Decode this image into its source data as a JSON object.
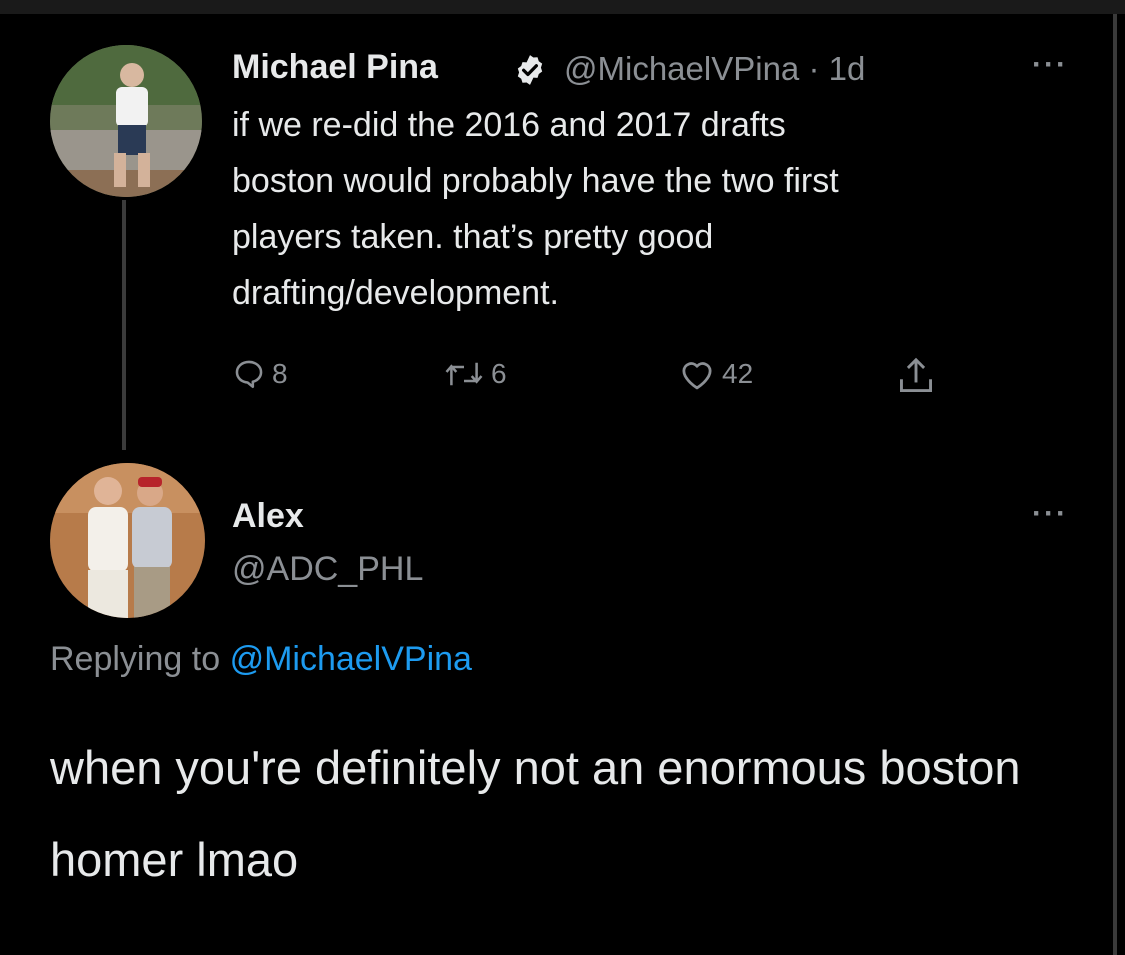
{
  "tweet": {
    "author_name": "Michael Pina",
    "verified": true,
    "handle": "@MichaelVPina",
    "separator": "·",
    "time": "1d",
    "text_lines": [
      "if we re-did the 2016 and 2017 drafts",
      "boston would probably have the two first",
      "players taken. that’s pretty good",
      "drafting/development."
    ],
    "more_label": "···",
    "reply_count": "8",
    "retweet_count": "6",
    "like_count": "42"
  },
  "reply": {
    "author_name": "Alex",
    "handle": "@ADC_PHL",
    "more_label": "···",
    "replying_prefix": "Replying to",
    "replying_to": "@MichaelVPina",
    "text": "when you're definitely not an enormous boston homer lmao"
  },
  "colors": {
    "background": "#000000",
    "text": "#e7e9ea",
    "muted": "#8b8f94",
    "link": "#1d9bf0"
  }
}
